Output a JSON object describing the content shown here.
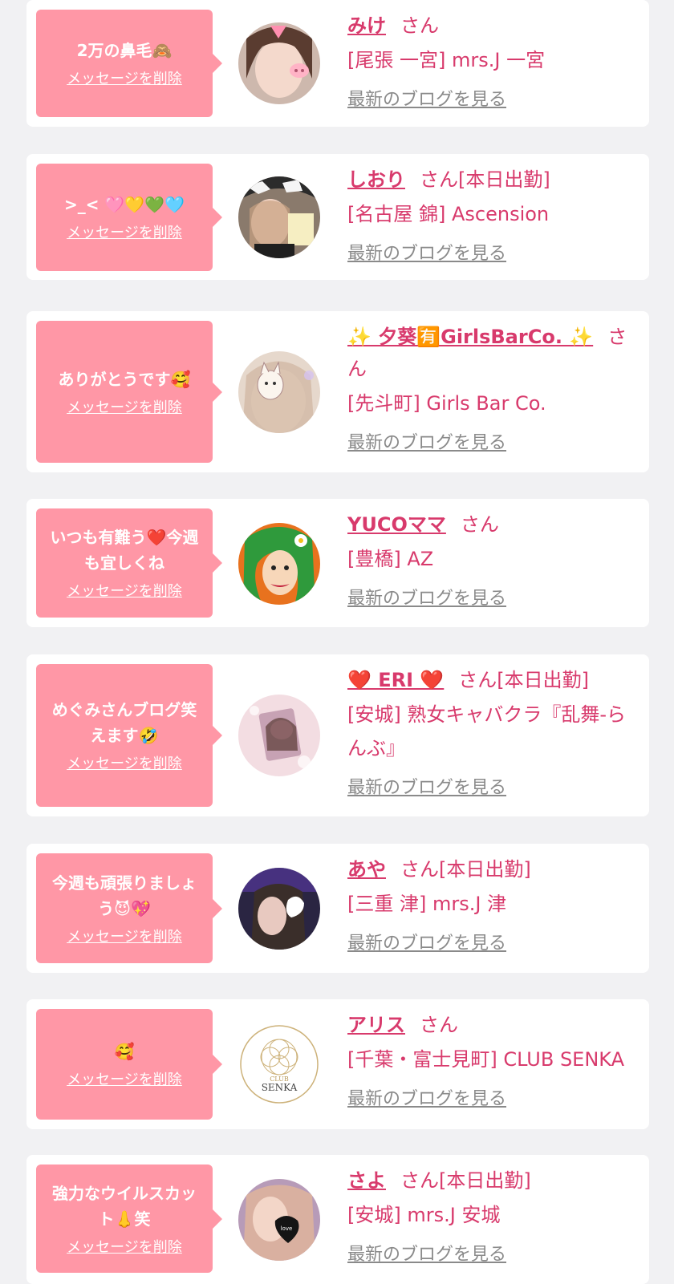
{
  "delete_label": "メッセージを削除",
  "blog_label": "最新のブログを見る",
  "colors": {
    "bubble": "#ff97a6",
    "name": "#d83a6c",
    "link": "#8a8a8a",
    "card": "#ffffff",
    "background": "#f1f1f3"
  },
  "items": [
    {
      "message": "2万の鼻毛🙈",
      "name": "みけ",
      "suffix": "さん",
      "shop": "[尾張 一宮] mrs.J 一宮"
    },
    {
      "message": ">_< 🩷💛💚🩵",
      "name": "しおり",
      "suffix": "さん[本日出勤]",
      "shop": "[名古屋 錦] Ascension"
    },
    {
      "message": "ありがとうです🥰",
      "name": "✨ 夕葵🈶GirlsBarCo. ✨",
      "suffix": "さん",
      "shop": "[先斗町] Girls Bar Co."
    },
    {
      "message": "いつも有難う❤️今週も宜しくね",
      "name": "YUCOママ",
      "suffix": "さん",
      "shop": "[豊橋] AZ"
    },
    {
      "message": "めぐみさんブログ笑えます🤣",
      "name": "❤️ ERI ❤️",
      "suffix": "さん[本日出勤]",
      "shop": "[安城] 熟女キャバクラ『乱舞-らんぶ』"
    },
    {
      "message": "今週も頑張りましょう😈💖",
      "name": "あや",
      "suffix": "さん[本日出勤]",
      "shop": "[三重 津] mrs.J 津"
    },
    {
      "message": "🥰",
      "name": "アリス",
      "suffix": "さん",
      "shop": "[千葉・富士見町] CLUB SENKA"
    },
    {
      "message": "強力なウイルスカット👃笑",
      "name": "さよ",
      "suffix": "さん[本日出勤]",
      "shop": "[安城] mrs.J 安城"
    }
  ],
  "avatar_logo": {
    "top": "CLUB",
    "main": "SENKA"
  },
  "avatar_overlay": {
    "sayo": "love"
  }
}
